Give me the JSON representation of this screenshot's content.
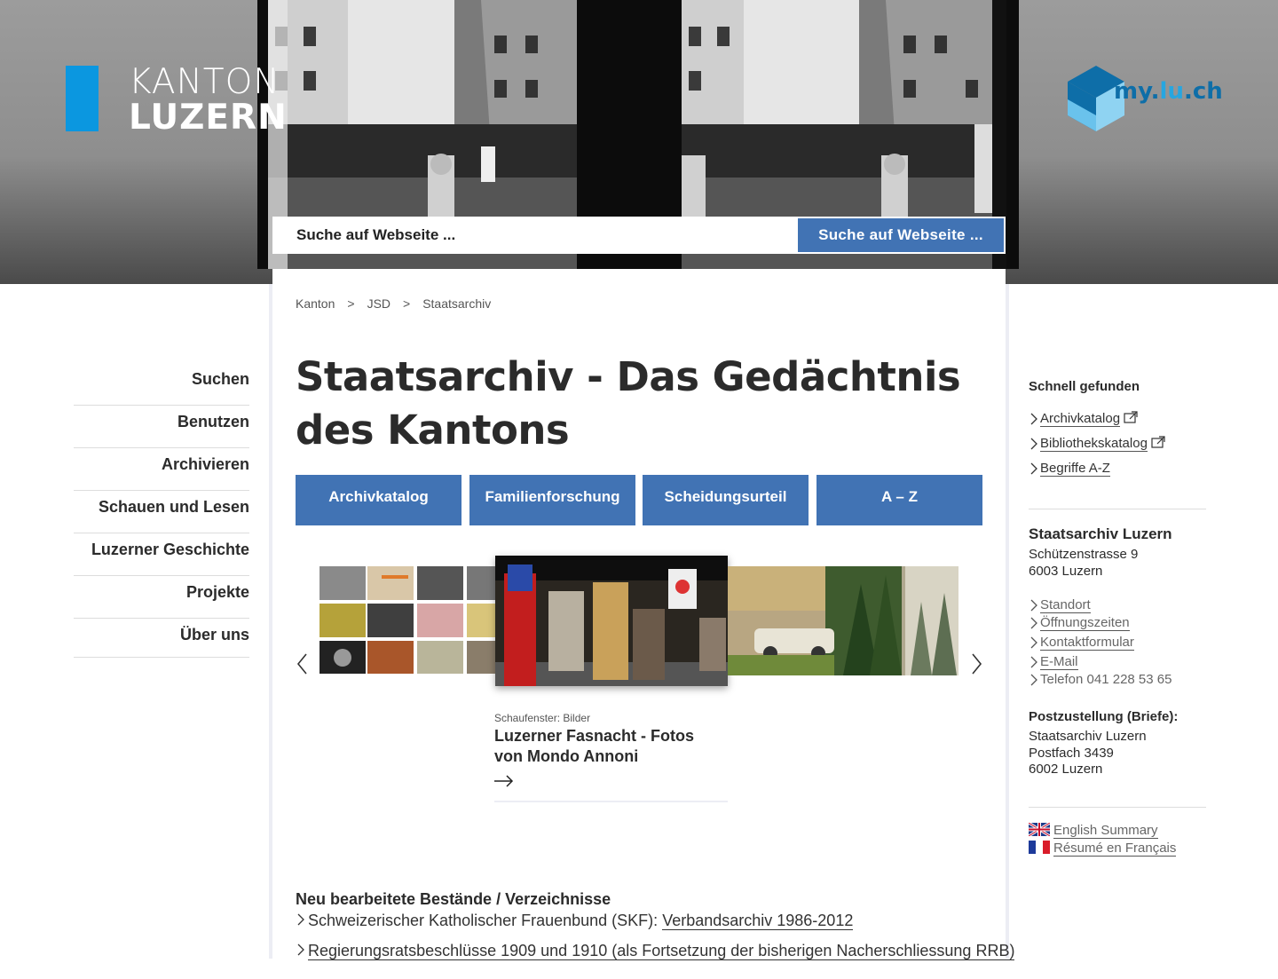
{
  "logo": {
    "line1": "KANTON",
    "line2": "LUZERN"
  },
  "mylu": {
    "part1": "my.",
    "part2": "lu",
    "part3": ".ch"
  },
  "search": {
    "placeholder": "Suche auf Webseite ...",
    "button_label": "Suche auf Webseite ..."
  },
  "breadcrumb": [
    "Kanton",
    "JSD",
    "Staatsarchiv"
  ],
  "breadcrumb_sep": ">",
  "page_title": "Staatsarchiv - Das Gedächtnis des Kantons",
  "tiles": [
    "Archivkatalog",
    "Familienforschung",
    "Scheidungsurteil",
    "A – Z"
  ],
  "carousel": {
    "kicker": "Schaufenster: Bilder",
    "title": "Luzerner Fasnacht - Fotos von Mondo Annoni"
  },
  "left_nav": [
    "Suchen",
    "Benutzen",
    "Archivieren",
    "Schauen und Lesen",
    "Luzerner Geschichte",
    "Projekte",
    "Über uns"
  ],
  "news": {
    "heading": "Neu bearbeitete Bestände / Verzeichnisse",
    "items": [
      {
        "prefix": "Schweizerischer Katholischer Frauenbund (SKF): ",
        "link": "Verbandsarchiv 1986-2012"
      },
      {
        "prefix": "Regierungsratsbeschlüsse 1909 und 1910 (als Fortsetzung der bisherigen Nacherschliessung RRB)",
        "link": ""
      }
    ]
  },
  "sidebar": {
    "quick_heading": "Schnell gefunden",
    "quick_links": [
      "Archivkatalog",
      "Bibliothekskatalog",
      "Begriffe A-Z"
    ],
    "org_name": "Staatsarchiv Luzern",
    "address": [
      "Schützenstrasse 9",
      "6003 Luzern"
    ],
    "contact_links": [
      "Standort",
      "Öffnungszeiten",
      "Kontaktformular",
      "E-Mail"
    ],
    "phone": "Telefon 041 228 53 65",
    "post_heading": "Postzustellung (Briefe):",
    "post_address": [
      "Staatsarchiv Luzern",
      "Postfach 3439",
      "6002 Luzern"
    ],
    "lang_links": [
      "English Summary",
      "Résumé en Français"
    ]
  },
  "colors": {
    "brand_blue": "#4173b4",
    "logo_blue": "#0b97e0",
    "text": "#2b2b2b"
  }
}
